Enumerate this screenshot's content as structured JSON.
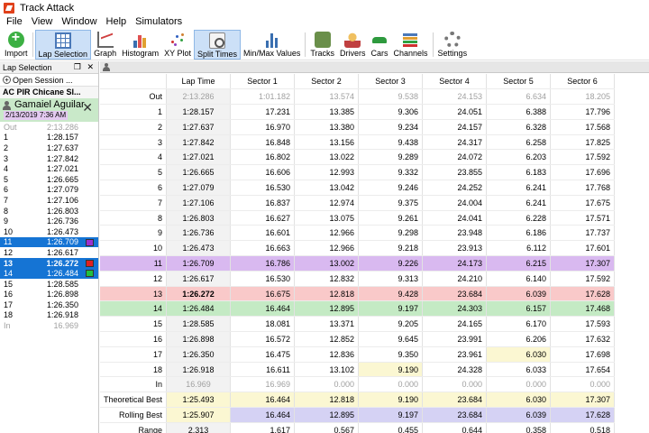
{
  "window": {
    "title": "Track Attack"
  },
  "menu": [
    "File",
    "View",
    "Window",
    "Help",
    "Simulators"
  ],
  "toolbar": [
    {
      "label": "Import",
      "icon": "import-icon",
      "active": false
    },
    {
      "label": "Lap Selection",
      "icon": "lap-selection-icon",
      "active": true
    },
    {
      "label": "Graph",
      "icon": "graph-icon",
      "active": false
    },
    {
      "label": "Histogram",
      "icon": "histogram-icon",
      "active": false
    },
    {
      "label": "XY Plot",
      "icon": "xy-plot-icon",
      "active": false
    },
    {
      "label": "Split Times",
      "icon": "split-times-icon",
      "active": true
    },
    {
      "label": "Min/Max Values",
      "icon": "min-max-icon",
      "active": false
    },
    {
      "label": "Tracks",
      "icon": "tracks-icon",
      "active": false
    },
    {
      "label": "Drivers",
      "icon": "drivers-icon",
      "active": false
    },
    {
      "label": "Cars",
      "icon": "cars-icon",
      "active": false
    },
    {
      "label": "Channels",
      "icon": "channels-icon",
      "active": false
    },
    {
      "label": "Settings",
      "icon": "settings-icon",
      "active": false
    }
  ],
  "lap_selection": {
    "header": "Lap Selection",
    "header_controls": "❐ ✕",
    "open_session": "Open Session ...",
    "session_title": "AC PIR Chicane SI...",
    "driver": {
      "name": "Gamaiel Aguilar",
      "date": "2/13/2019 7:36 AM",
      "close": "✕"
    },
    "laps": [
      {
        "n": "Out",
        "t": "2:13.286",
        "state": "muted"
      },
      {
        "n": "1",
        "t": "1:28.157",
        "state": ""
      },
      {
        "n": "2",
        "t": "1:27.637",
        "state": ""
      },
      {
        "n": "3",
        "t": "1:27.842",
        "state": ""
      },
      {
        "n": "4",
        "t": "1:27.021",
        "state": ""
      },
      {
        "n": "5",
        "t": "1:26.665",
        "state": ""
      },
      {
        "n": "6",
        "t": "1:27.079",
        "state": ""
      },
      {
        "n": "7",
        "t": "1:27.106",
        "state": ""
      },
      {
        "n": "8",
        "t": "1:26.803",
        "state": ""
      },
      {
        "n": "9",
        "t": "1:26.736",
        "state": ""
      },
      {
        "n": "10",
        "t": "1:26.473",
        "state": ""
      },
      {
        "n": "11",
        "t": "1:26.709",
        "state": "sel",
        "swatch": "#9b30d0"
      },
      {
        "n": "12",
        "t": "1:26.617",
        "state": ""
      },
      {
        "n": "13",
        "t": "1:26.272",
        "state": "sel best",
        "swatch": "#e02020"
      },
      {
        "n": "14",
        "t": "1:26.484",
        "state": "sel",
        "swatch": "#20c040"
      },
      {
        "n": "15",
        "t": "1:28.585",
        "state": ""
      },
      {
        "n": "16",
        "t": "1:26.898",
        "state": ""
      },
      {
        "n": "17",
        "t": "1:26.350",
        "state": ""
      },
      {
        "n": "18",
        "t": "1:26.918",
        "state": ""
      },
      {
        "n": "In",
        "t": "16.969",
        "state": "muted"
      }
    ]
  },
  "split_table": {
    "columns": [
      "",
      "Lap Time",
      "Sector 1",
      "Sector 2",
      "Sector 3",
      "Sector 4",
      "Sector 5",
      "Sector 6"
    ],
    "rows": [
      {
        "label": "Out",
        "cls": "out",
        "cells": [
          "2:13.286",
          "1:01.182",
          "13.574",
          "9.538",
          "24.153",
          "6.634",
          "18.205"
        ],
        "hl": [
          "",
          "",
          "",
          "",
          "",
          "",
          ""
        ]
      },
      {
        "label": "1",
        "cls": "",
        "cells": [
          "1:28.157",
          "17.231",
          "13.385",
          "9.306",
          "24.051",
          "6.388",
          "17.796"
        ],
        "hl": [
          "",
          "",
          "",
          "",
          "",
          "",
          ""
        ]
      },
      {
        "label": "2",
        "cls": "",
        "cells": [
          "1:27.637",
          "16.970",
          "13.380",
          "9.234",
          "24.157",
          "6.328",
          "17.568"
        ],
        "hl": [
          "",
          "",
          "",
          "",
          "",
          "",
          ""
        ]
      },
      {
        "label": "3",
        "cls": "",
        "cells": [
          "1:27.842",
          "16.848",
          "13.156",
          "9.438",
          "24.317",
          "6.258",
          "17.825"
        ],
        "hl": [
          "",
          "",
          "",
          "",
          "",
          "",
          ""
        ]
      },
      {
        "label": "4",
        "cls": "",
        "cells": [
          "1:27.021",
          "16.802",
          "13.022",
          "9.289",
          "24.072",
          "6.203",
          "17.592"
        ],
        "hl": [
          "",
          "",
          "",
          "",
          "",
          "",
          ""
        ]
      },
      {
        "label": "5",
        "cls": "",
        "cells": [
          "1:26.665",
          "16.606",
          "12.993",
          "9.332",
          "23.855",
          "6.183",
          "17.696"
        ],
        "hl": [
          "",
          "",
          "",
          "",
          "",
          "",
          ""
        ]
      },
      {
        "label": "6",
        "cls": "",
        "cells": [
          "1:27.079",
          "16.530",
          "13.042",
          "9.246",
          "24.252",
          "6.241",
          "17.768"
        ],
        "hl": [
          "",
          "",
          "",
          "",
          "",
          "",
          ""
        ]
      },
      {
        "label": "7",
        "cls": "",
        "cells": [
          "1:27.106",
          "16.837",
          "12.974",
          "9.375",
          "24.004",
          "6.241",
          "17.675"
        ],
        "hl": [
          "",
          "",
          "",
          "",
          "",
          "",
          ""
        ]
      },
      {
        "label": "8",
        "cls": "",
        "cells": [
          "1:26.803",
          "16.627",
          "13.075",
          "9.261",
          "24.041",
          "6.228",
          "17.571"
        ],
        "hl": [
          "",
          "",
          "",
          "",
          "",
          "",
          ""
        ]
      },
      {
        "label": "9",
        "cls": "",
        "cells": [
          "1:26.736",
          "16.601",
          "12.966",
          "9.298",
          "23.948",
          "6.186",
          "17.737"
        ],
        "hl": [
          "",
          "",
          "",
          "",
          "",
          "",
          ""
        ]
      },
      {
        "label": "10",
        "cls": "",
        "cells": [
          "1:26.473",
          "16.663",
          "12.966",
          "9.218",
          "23.913",
          "6.112",
          "17.601"
        ],
        "hl": [
          "",
          "",
          "",
          "",
          "",
          "",
          ""
        ]
      },
      {
        "label": "11",
        "cls": "purple",
        "cells": [
          "1:26.709",
          "16.786",
          "13.002",
          "9.226",
          "24.173",
          "6.215",
          "17.307"
        ],
        "hl": [
          "",
          "",
          "",
          "",
          "",
          "",
          "yellow"
        ]
      },
      {
        "label": "12",
        "cls": "",
        "cells": [
          "1:26.617",
          "16.530",
          "12.832",
          "9.313",
          "24.210",
          "6.140",
          "17.592"
        ],
        "hl": [
          "",
          "",
          "",
          "",
          "",
          "",
          ""
        ]
      },
      {
        "label": "13",
        "cls": "red",
        "cells": [
          "1:26.272",
          "16.675",
          "12.818",
          "9.428",
          "23.684",
          "6.039",
          "17.628"
        ],
        "hl": [
          "bold",
          "",
          "yellow",
          "red",
          "lav",
          "lav",
          ""
        ]
      },
      {
        "label": "14",
        "cls": "green",
        "cells": [
          "1:26.484",
          "16.464",
          "12.895",
          "9.197",
          "24.303",
          "6.157",
          "17.468"
        ],
        "hl": [
          "",
          "yellow",
          "lav",
          "lav",
          "",
          "",
          ""
        ]
      },
      {
        "label": "15",
        "cls": "",
        "cells": [
          "1:28.585",
          "18.081",
          "13.371",
          "9.205",
          "24.165",
          "6.170",
          "17.593"
        ],
        "hl": [
          "",
          "",
          "",
          "",
          "",
          "",
          ""
        ]
      },
      {
        "label": "16",
        "cls": "",
        "cells": [
          "1:26.898",
          "16.572",
          "12.852",
          "9.645",
          "23.991",
          "6.206",
          "17.632"
        ],
        "hl": [
          "",
          "",
          "",
          "",
          "",
          "",
          ""
        ]
      },
      {
        "label": "17",
        "cls": "",
        "cells": [
          "1:26.350",
          "16.475",
          "12.836",
          "9.350",
          "23.961",
          "6.030",
          "17.698"
        ],
        "hl": [
          "",
          "",
          "",
          "",
          "",
          "yellow",
          ""
        ]
      },
      {
        "label": "18",
        "cls": "",
        "cells": [
          "1:26.918",
          "16.611",
          "13.102",
          "9.190",
          "24.328",
          "6.033",
          "17.654"
        ],
        "hl": [
          "",
          "",
          "",
          "yellow",
          "",
          "",
          ""
        ]
      },
      {
        "label": "In",
        "cls": "in",
        "cells": [
          "16.969",
          "16.969",
          "0.000",
          "0.000",
          "0.000",
          "0.000",
          "0.000"
        ],
        "hl": [
          "",
          "",
          "",
          "",
          "",
          "",
          ""
        ]
      },
      {
        "label": "Theoretical Best",
        "cls": "theo",
        "cells": [
          "1:25.493",
          "16.464",
          "12.818",
          "9.190",
          "23.684",
          "6.030",
          "17.307"
        ],
        "hl": [
          "",
          "",
          "",
          "",
          "",
          "",
          ""
        ]
      },
      {
        "label": "Rolling Best",
        "cls": "roll",
        "cells": [
          "1:25.907",
          "16.464",
          "12.895",
          "9.197",
          "23.684",
          "6.039",
          "17.628"
        ],
        "hl": [
          "",
          "lav",
          "lav",
          "lav",
          "lav",
          "lav",
          "lav"
        ]
      },
      {
        "label": "Range",
        "cls": "",
        "cells": [
          "2.313",
          "1.617",
          "0.567",
          "0.455",
          "0.644",
          "0.358",
          "0.518"
        ],
        "hl": [
          "",
          "",
          "",
          "",
          "",
          "",
          ""
        ]
      }
    ]
  }
}
